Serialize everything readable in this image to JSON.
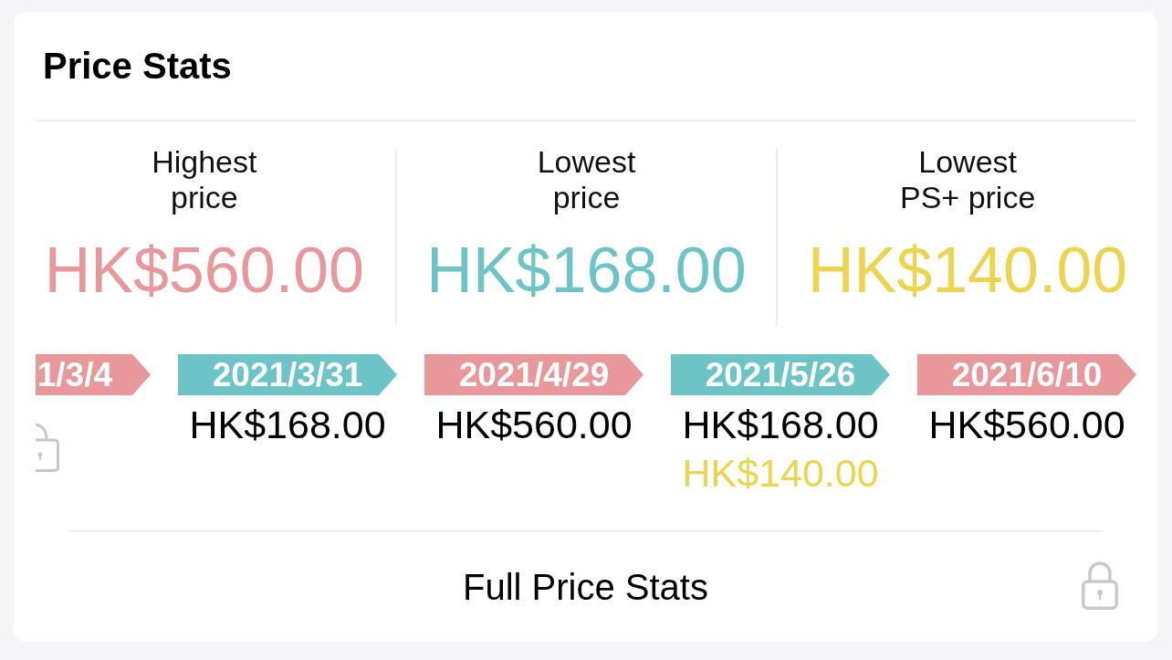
{
  "title": "Price Stats",
  "stats": [
    {
      "label": "Highest\nprice",
      "value": "HK$560.00",
      "color": "#e8979a"
    },
    {
      "label": "Lowest\nprice",
      "value": "HK$168.00",
      "color": "#6cc4c7"
    },
    {
      "label": "Lowest\nPS+ price",
      "value": "HK$140.00",
      "color": "#ecd44e"
    }
  ],
  "timeline": [
    {
      "kind": "cut",
      "date": "1/3/4",
      "color": "#e8979a"
    },
    {
      "kind": "full",
      "date": "2021/3/31",
      "color": "#6cc4c7",
      "prices": [
        {
          "kind": "regular",
          "value": "HK$168.00"
        }
      ]
    },
    {
      "kind": "full",
      "date": "2021/4/29",
      "color": "#e8979a",
      "prices": [
        {
          "kind": "regular",
          "value": "HK$560.00"
        }
      ]
    },
    {
      "kind": "full",
      "date": "2021/5/26",
      "color": "#6cc4c7",
      "prices": [
        {
          "kind": "regular",
          "value": "HK$168.00"
        },
        {
          "kind": "plus",
          "value": "HK$140.00"
        }
      ]
    },
    {
      "kind": "full",
      "date": "2021/6/10",
      "color": "#e8979a",
      "prices": [
        {
          "kind": "regular",
          "value": "HK$560.00"
        }
      ]
    }
  ],
  "footer": {
    "link": "Full Price Stats"
  }
}
